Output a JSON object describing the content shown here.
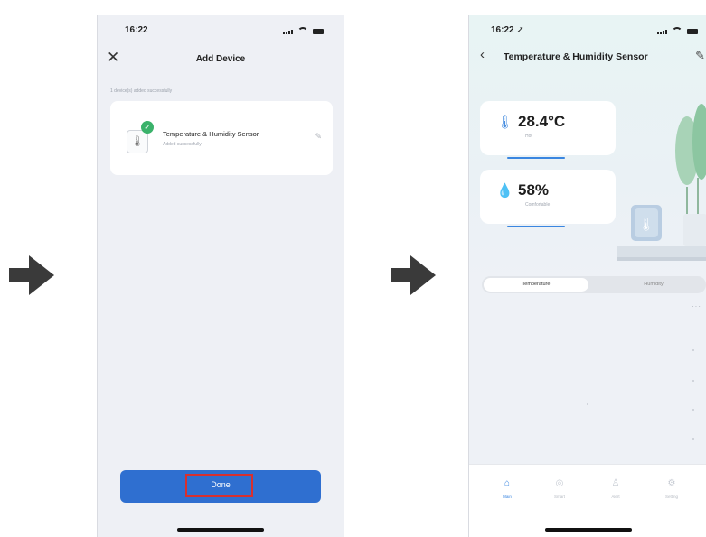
{
  "colors": {
    "accent": "#2f6fd0",
    "highlight": "#d8302f",
    "success": "#3bb26b",
    "arrow": "#3a3a3a"
  },
  "phone1": {
    "status_time": "16:22",
    "title": "Add Device",
    "info_text": "1 device(s) added successfully",
    "device": {
      "name": "Temperature & Humidity Sensor",
      "status": "Added successfully",
      "icon": "thermometer-icon"
    },
    "done_label": "Done"
  },
  "phone2": {
    "status_time": "16:22 ➚",
    "title": "Temperature & Humidity Sensor",
    "temperature": {
      "value": "28.4°C",
      "sub": "Hot"
    },
    "humidity": {
      "value": "58%",
      "sub": "Comfortable"
    },
    "tabs": {
      "temperature": "Temperature",
      "humidity": "Humidity"
    },
    "nav": [
      {
        "label": "Main",
        "icon": "home-icon"
      },
      {
        "label": "Smart",
        "icon": "smart-icon"
      },
      {
        "label": "Alert",
        "icon": "alert-icon"
      },
      {
        "label": "Setting",
        "icon": "gear-icon"
      }
    ]
  }
}
